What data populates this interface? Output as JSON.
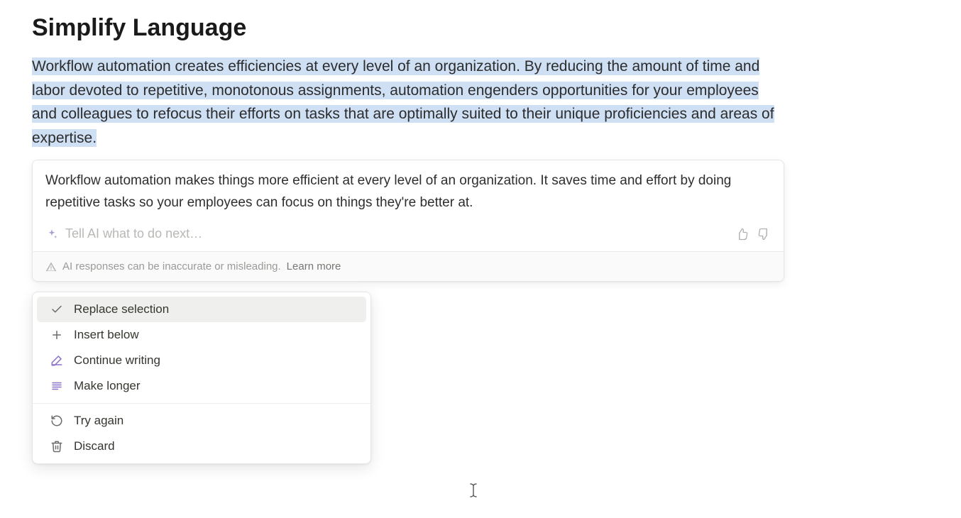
{
  "page": {
    "title": "Simplify Language",
    "original_text": "Workflow automation creates efficiencies at every level of an organization. By reducing the amount of time and labor devoted to repetitive, monotonous assignments, automation engenders opportunities for your employees and colleagues to refocus their efforts on tasks that are optimally suited to their unique proficiencies and areas of expertise."
  },
  "ai": {
    "response": "Workflow automation makes things more efficient at every level of an organization. It saves time and effort by doing repetitive tasks so your employees can focus on things they're better at.",
    "input_placeholder": "Tell AI what to do next…",
    "disclaimer": "AI responses can be inaccurate or misleading.",
    "learn_more": "Learn more"
  },
  "menu": {
    "items": [
      {
        "label": "Replace selection",
        "icon": "check",
        "highlighted": true
      },
      {
        "label": "Insert below",
        "icon": "plus",
        "highlighted": false
      },
      {
        "label": "Continue writing",
        "icon": "pencil-line",
        "highlighted": false
      },
      {
        "label": "Make longer",
        "icon": "lines",
        "highlighted": false
      }
    ],
    "items2": [
      {
        "label": "Try again",
        "icon": "retry",
        "highlighted": false
      },
      {
        "label": "Discard",
        "icon": "trash",
        "highlighted": false
      }
    ]
  }
}
